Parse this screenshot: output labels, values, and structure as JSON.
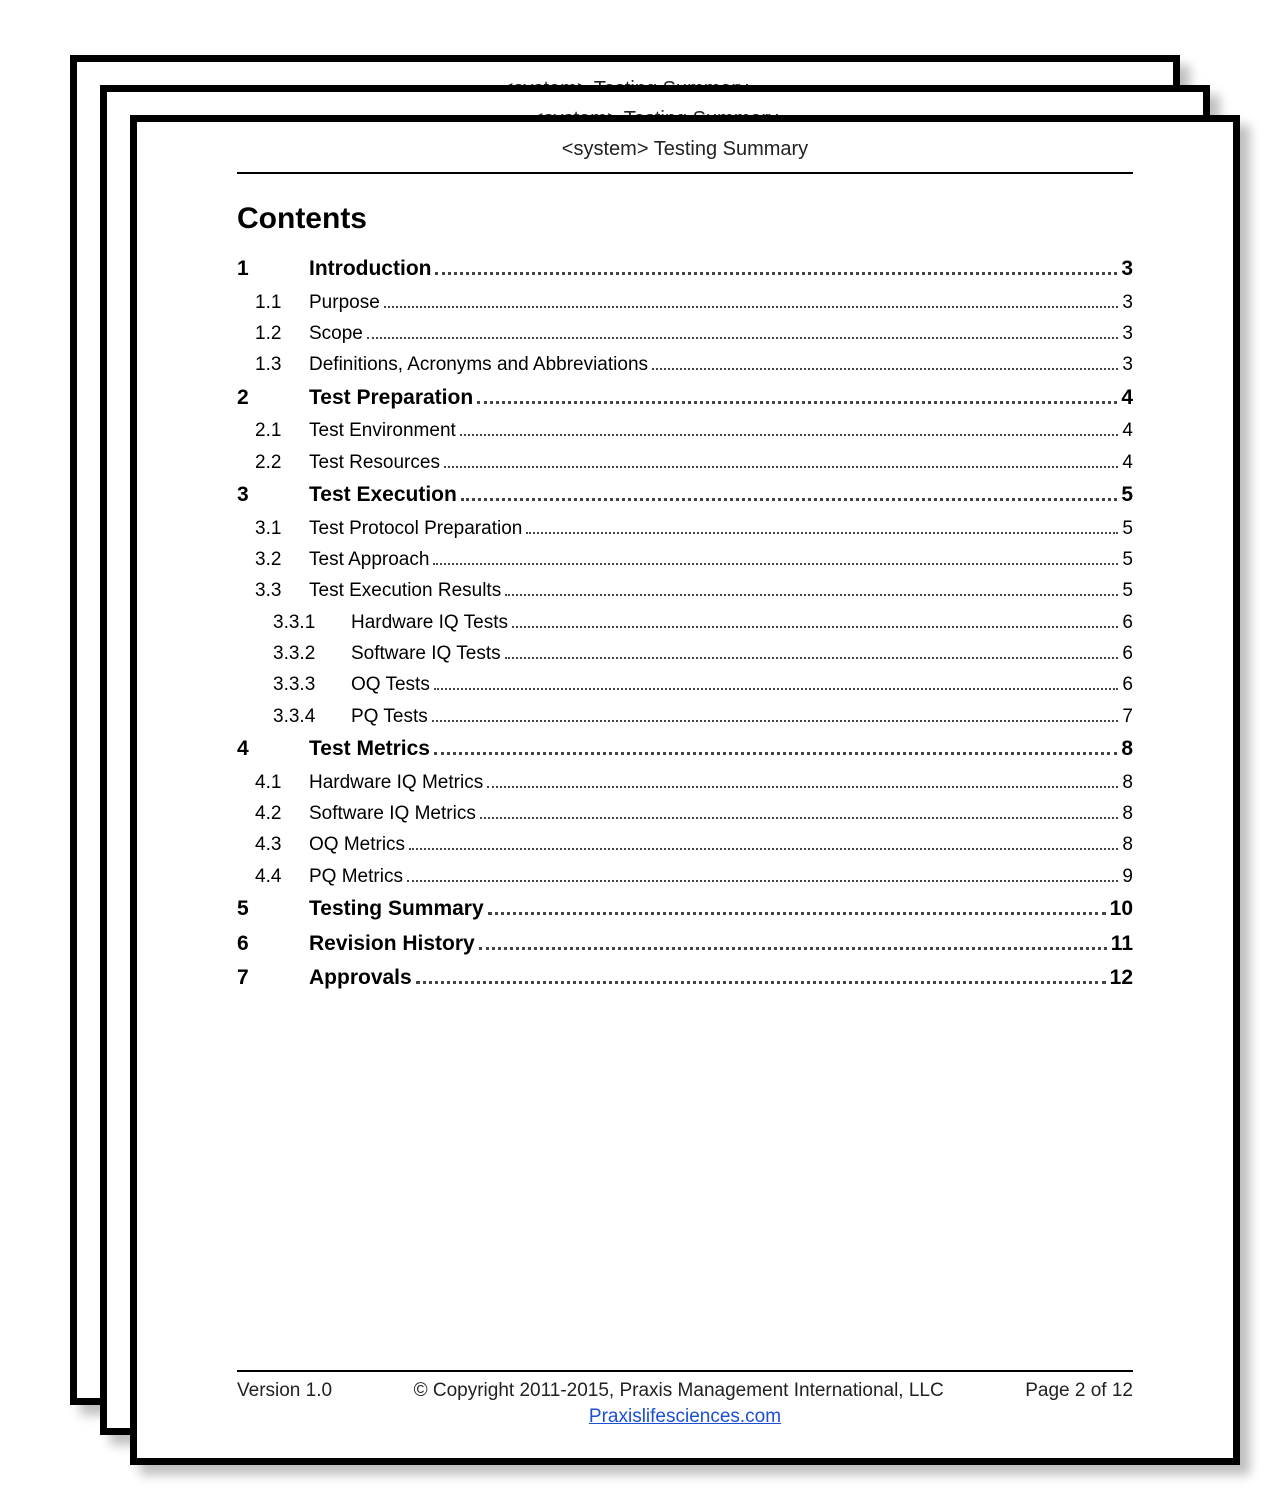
{
  "header_title": "<system> Testing Summary",
  "contents_heading": "Contents",
  "toc": [
    {
      "level": 1,
      "num": "1",
      "title": "Introduction",
      "page": "3"
    },
    {
      "level": 2,
      "num": "1.1",
      "title": "Purpose",
      "page": "3"
    },
    {
      "level": 2,
      "num": "1.2",
      "title": "Scope",
      "page": "3"
    },
    {
      "level": 2,
      "num": "1.3",
      "title": "Definitions, Acronyms and Abbreviations",
      "page": "3"
    },
    {
      "level": 1,
      "num": "2",
      "title": "Test Preparation",
      "page": "4"
    },
    {
      "level": 2,
      "num": "2.1",
      "title": "Test Environment",
      "page": "4"
    },
    {
      "level": 2,
      "num": "2.2",
      "title": "Test Resources",
      "page": "4"
    },
    {
      "level": 1,
      "num": "3",
      "title": "Test Execution",
      "page": "5"
    },
    {
      "level": 2,
      "num": "3.1",
      "title": "Test Protocol Preparation",
      "page": "5"
    },
    {
      "level": 2,
      "num": "3.2",
      "title": "Test Approach",
      "page": "5"
    },
    {
      "level": 2,
      "num": "3.3",
      "title": "Test Execution Results",
      "page": "5"
    },
    {
      "level": 3,
      "num": "3.3.1",
      "title": "Hardware IQ Tests",
      "page": "6"
    },
    {
      "level": 3,
      "num": "3.3.2",
      "title": "Software IQ Tests",
      "page": "6"
    },
    {
      "level": 3,
      "num": "3.3.3",
      "title": "OQ Tests",
      "page": "6"
    },
    {
      "level": 3,
      "num": "3.3.4",
      "title": "PQ Tests",
      "page": "7"
    },
    {
      "level": 1,
      "num": "4",
      "title": "Test Metrics",
      "page": "8"
    },
    {
      "level": 2,
      "num": "4.1",
      "title": "Hardware IQ Metrics",
      "page": "8"
    },
    {
      "level": 2,
      "num": "4.2",
      "title": "Software IQ Metrics",
      "page": "8"
    },
    {
      "level": 2,
      "num": "4.3",
      "title": "OQ Metrics",
      "page": "8"
    },
    {
      "level": 2,
      "num": "4.4",
      "title": "PQ Metrics",
      "page": "9"
    },
    {
      "level": 1,
      "num": "5",
      "title": "Testing Summary",
      "page": "10"
    },
    {
      "level": 1,
      "num": "6",
      "title": "Revision History",
      "page": "11"
    },
    {
      "level": 1,
      "num": "7",
      "title": "Approvals",
      "page": "12"
    }
  ],
  "footer": {
    "version": "Version 1.0",
    "copyright": "© Copyright 2011-2015, Praxis Management International, LLC",
    "page": "Page 2 of 12",
    "link_text": "Praxislifesciences.com",
    "link_href": "#"
  }
}
